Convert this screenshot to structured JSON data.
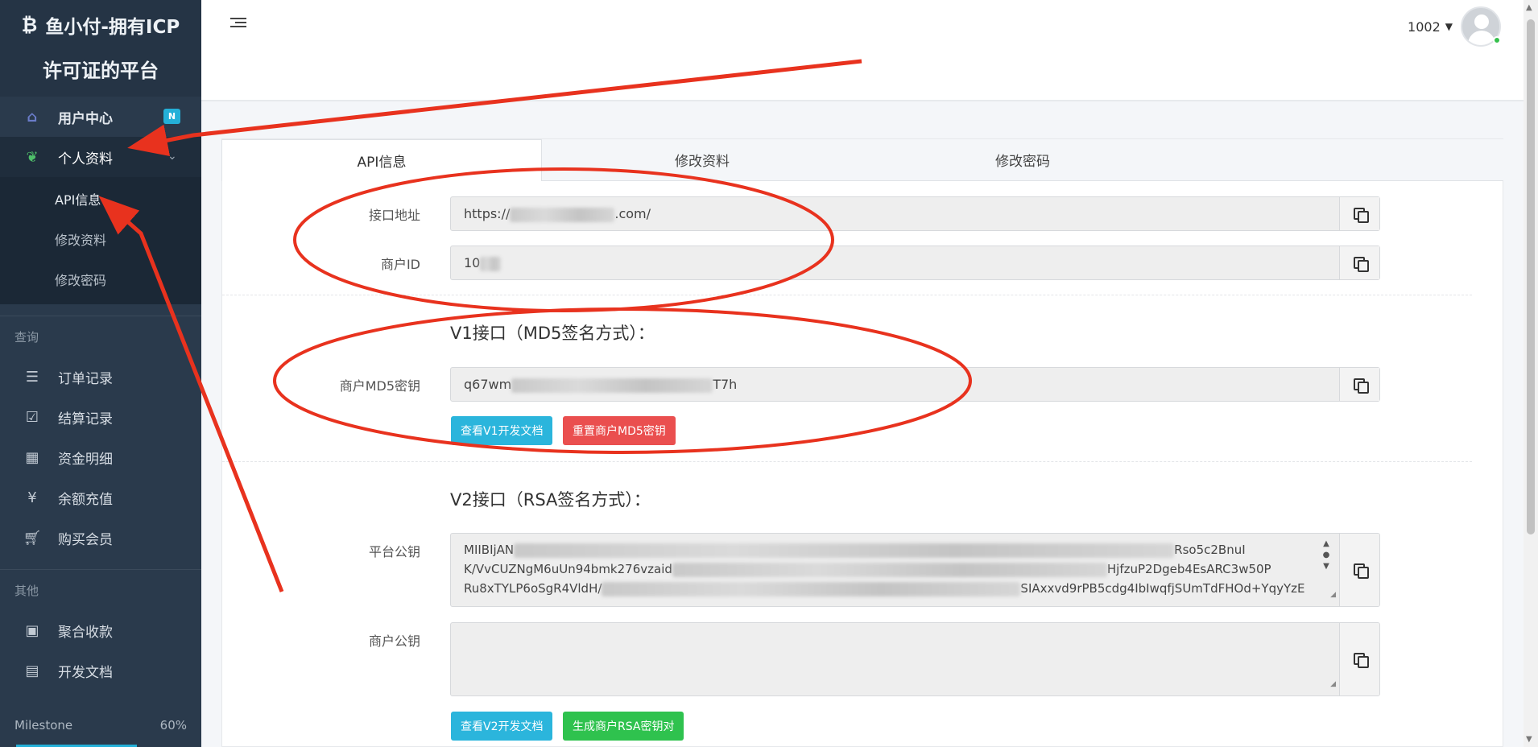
{
  "brand": {
    "line1": "鱼小付-拥有ICP",
    "line2": "许可证的平台",
    "icon": "bitcoin-icon"
  },
  "sidebar": {
    "user_center": {
      "label": "用户中心",
      "badge": "N",
      "icon": "home-icon"
    },
    "profile": {
      "label": "个人资料",
      "icon": "leaf-icon"
    },
    "profile_sub": [
      "API信息",
      "修改资料",
      "修改密码"
    ],
    "query_title": "查询",
    "query_items": [
      {
        "label": "订单记录",
        "icon": "list-icon"
      },
      {
        "label": "结算记录",
        "icon": "check-square-icon"
      },
      {
        "label": "资金明细",
        "icon": "calendar-icon"
      },
      {
        "label": "余额充值",
        "icon": "yen-icon"
      },
      {
        "label": "购买会员",
        "icon": "cart-icon"
      }
    ],
    "other_title": "其他",
    "other_items": [
      {
        "label": "聚合收款",
        "icon": "qrcode-icon"
      },
      {
        "label": "开发文档",
        "icon": "book-icon"
      }
    ],
    "milestone": {
      "label": "Milestone",
      "percent": "60%",
      "progress": 0.6
    }
  },
  "header": {
    "user_id": "1002"
  },
  "tabs": [
    "API信息",
    "修改资料",
    "修改密码"
  ],
  "form": {
    "api_url": {
      "label": "接口地址",
      "value_start": "https://",
      "value_end": ".com/"
    },
    "merchant_id": {
      "label": "商户ID",
      "value_start": "10"
    },
    "v1": {
      "title": "V1接口（MD5签名方式）：",
      "md5_label": "商户MD5密钥",
      "md5_start": "q67wm",
      "md5_end": "T7h",
      "btn_doc": "查看V1开发文档",
      "btn_reset": "重置商户MD5密钥"
    },
    "v2": {
      "title": "V2接口（RSA签名方式）：",
      "platform_key_label": "平台公钥",
      "platform_key_line1_start": "MIIBIjAN",
      "platform_key_line1_end": "Rso5c2BnuI",
      "platform_key_line2_start": "K/VvCUZNgM6uUn94bmk276vzaid",
      "platform_key_line2_end": "HjfzuP2Dgeb4EsARC3w50P",
      "platform_key_line3_start": "Ru8xTYLP6oSgR4VldH/",
      "platform_key_line3_end": "SIAxxvd9rPB5cdg4IbIwqfjSUmTdFHOd+YqyYzE",
      "merchant_key_label": "商户公钥",
      "btn_doc": "查看V2开发文档",
      "btn_gen": "生成商户RSA密钥对"
    }
  },
  "colors": {
    "sidebar": "#2a3a4c",
    "info": "#2bb5dc",
    "danger": "#ea4f4f",
    "success": "#2fc24e",
    "annotation": "#e8321e"
  }
}
